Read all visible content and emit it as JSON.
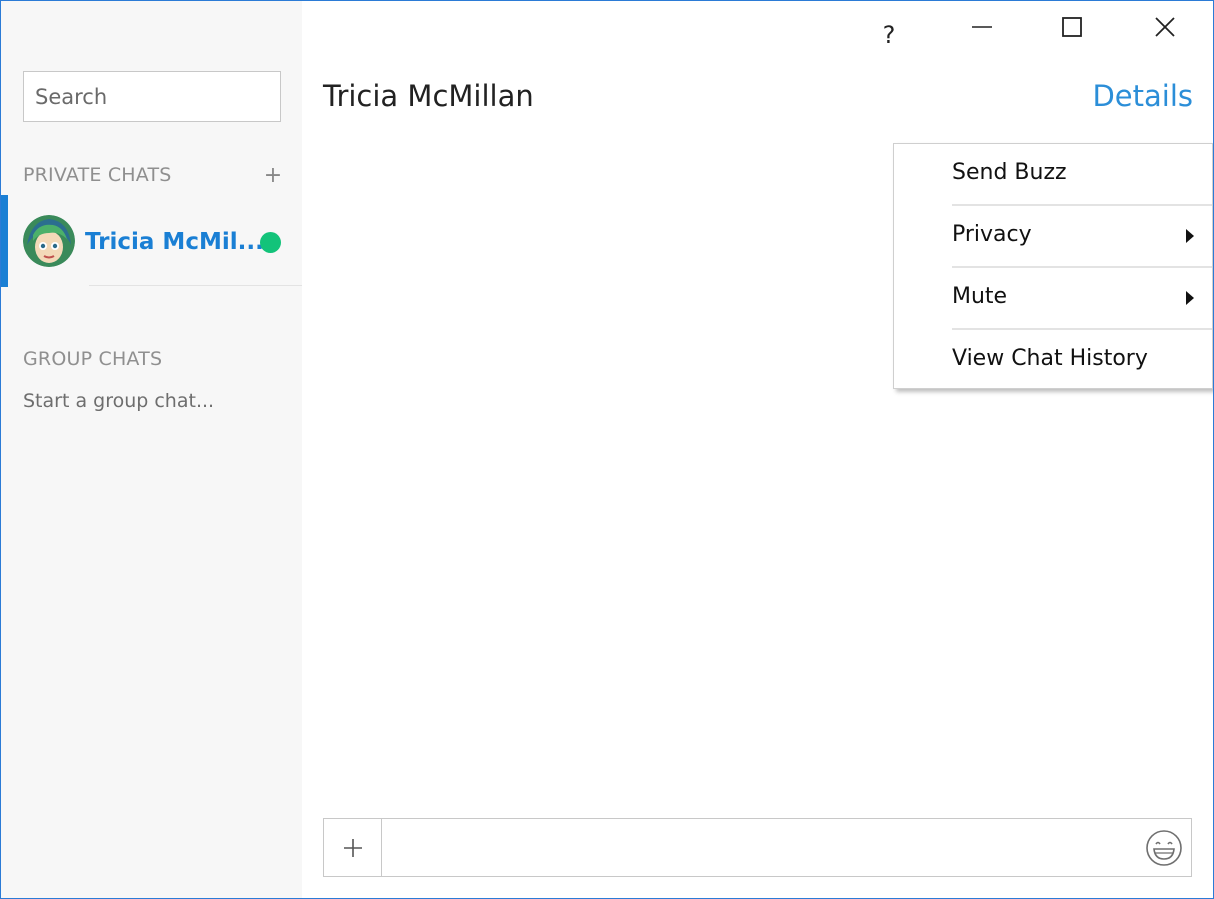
{
  "sidebar": {
    "search_placeholder": "Search",
    "private_header": "PRIVATE CHATS",
    "add_label": "+",
    "chats": [
      {
        "name": "Tricia McMil...",
        "status": "online"
      }
    ],
    "group_header": "GROUP CHATS",
    "group_placeholder": "Start a group chat..."
  },
  "titlebar": {
    "help_label": "?"
  },
  "conversation": {
    "title": "Tricia McMillan",
    "details_label": "Details"
  },
  "menu": {
    "items": [
      {
        "label": "Send Buzz",
        "submenu": false
      },
      {
        "label": "Privacy",
        "submenu": true
      },
      {
        "label": "Mute",
        "submenu": true
      },
      {
        "label": "View Chat History",
        "submenu": false
      }
    ]
  },
  "composer": {
    "message_value": ""
  },
  "colors": {
    "accent": "#1a7fd4",
    "online": "#13c37a",
    "link": "#2b8ed8",
    "window_border": "#2b7bd6"
  }
}
